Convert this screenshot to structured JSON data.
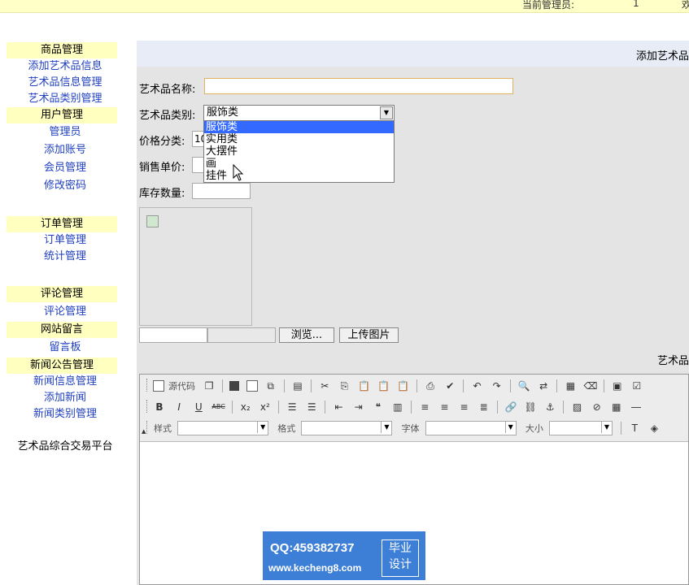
{
  "topbar": {
    "label": "当前管理员:",
    "value": "1",
    "trail": "欢"
  },
  "sidebar": {
    "sections": [
      {
        "title": "商品管理",
        "links": [
          "添加艺术品信息",
          "艺术品信息管理",
          "艺术品类别管理"
        ]
      },
      {
        "title": "用户管理",
        "links": [
          "管理员",
          "添加账号",
          "会员管理",
          "修改密码"
        ]
      },
      {
        "title": "订单管理",
        "links": [
          "订单管理",
          "统计管理"
        ]
      },
      {
        "title": "评论管理",
        "links": [
          "评论管理"
        ]
      },
      {
        "title": "网站留言",
        "links": [
          "留言板"
        ]
      },
      {
        "title": "新闻公告管理",
        "links": [
          "新闻信息管理",
          "添加新闻",
          "新闻类别管理"
        ]
      }
    ],
    "brand": "艺术品综合交易平台"
  },
  "main": {
    "header": "添加艺术品",
    "form": {
      "name_label": "艺术品名称:",
      "name_value": "",
      "category_label": "艺术品类别:",
      "category_selected": "服饰类",
      "category_options": [
        "服饰类",
        "实用类",
        "大摆件",
        "画",
        "挂件"
      ],
      "price_type_label": "价格分类:",
      "price_type_value": "10",
      "unit_price_label": "销售单价:",
      "stock_label": "库存数量:",
      "browse_button": "浏览...",
      "upload_button": "上传图片",
      "right_label": "艺术品"
    },
    "editor": {
      "source_label": "源代码",
      "style_label": "样式",
      "format_label": "格式",
      "font_label": "字体",
      "size_label": "大小"
    }
  },
  "watermark": {
    "qq": "QQ:459382737",
    "url": "www.kecheng8.com",
    "badge_line1": "毕业",
    "badge_line2": "设计"
  }
}
